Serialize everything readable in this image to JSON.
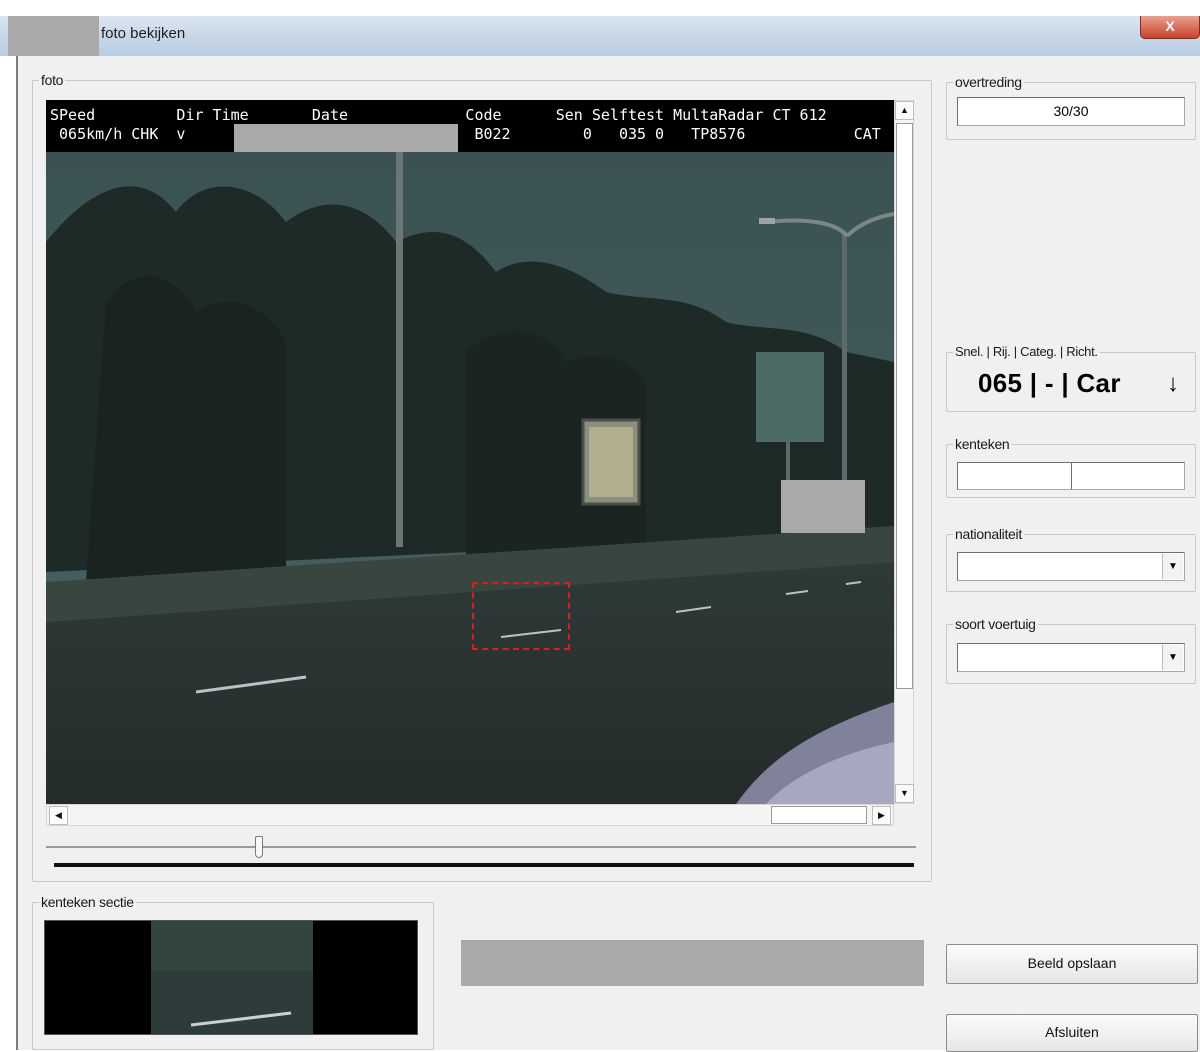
{
  "window": {
    "title": "foto bekijken",
    "close_label": "X"
  },
  "foto_group": {
    "legend": "foto",
    "osd": {
      "line1": "SPeed         Dir Time       Date             Code      Sen Selftest MultaRadar CT 612",
      "line2": " 065km/h CHK  v                                B022        0   035 0   TP8576            CAT"
    }
  },
  "overtreding": {
    "legend": "overtreding",
    "value": "30/30"
  },
  "speed_group": {
    "legend": "Snel. | Rij. | Categ. | Richt.",
    "value": "065 | - | Car",
    "direction_icon": "down-arrow-icon",
    "direction_glyph": "↓"
  },
  "kenteken": {
    "legend": "kenteken",
    "part1": "",
    "part2": ""
  },
  "nationaliteit": {
    "legend": "nationaliteit",
    "value": ""
  },
  "soort_voertuig": {
    "legend": "soort voertuig",
    "value": ""
  },
  "kenteken_sectie": {
    "legend": "kenteken sectie"
  },
  "buttons": {
    "save_label": "Beeld opslaan",
    "close_label": "Afsluiten"
  },
  "scroll_arrows": {
    "up": "▲",
    "down": "▼",
    "left": "◀",
    "right": "▶",
    "combo": "▼"
  },
  "colors": {
    "roi_box": "#e31a1a",
    "redaction": "#a9a9a9"
  }
}
